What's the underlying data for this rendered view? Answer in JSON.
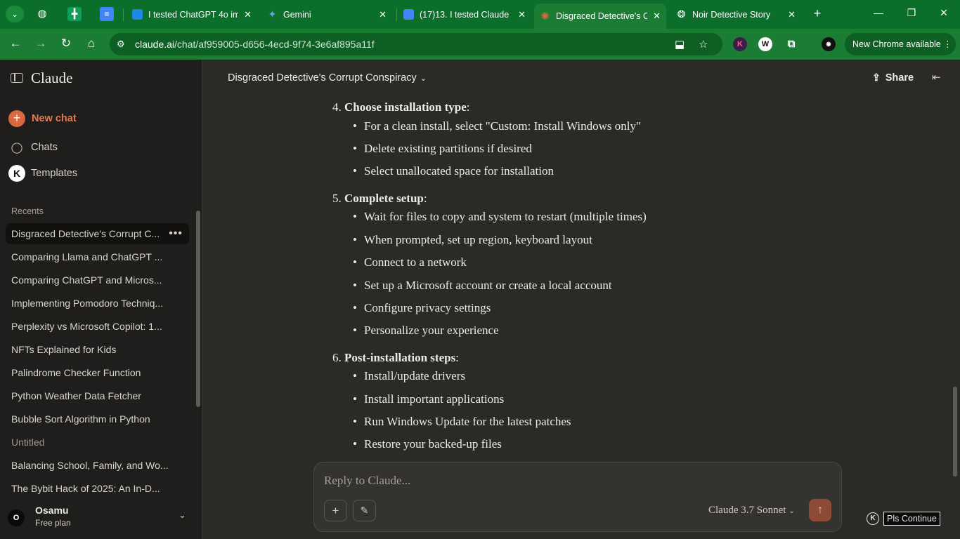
{
  "browser": {
    "tabs": [
      {
        "title": "I tested ChatGPT 4o im",
        "fav_color": "#1e88e5"
      },
      {
        "title": "Gemini",
        "fav_color": "#4d8af0"
      },
      {
        "title": "(17)13. I tested Claude",
        "fav_color": "#4285f4"
      },
      {
        "title": "Disgraced Detective's C",
        "fav_color": "#d9673f"
      },
      {
        "title": "Noir Detective Story",
        "fav_color": "#e8e8e8"
      }
    ],
    "url_host": "claude.ai",
    "url_path": "/chat/af959005-d656-4ecd-9f74-3e6af895a11f",
    "new_chrome_label": "New Chrome available"
  },
  "sidebar": {
    "brand": "Claude",
    "new_chat": "New chat",
    "nav": [
      {
        "label": "Chats",
        "icon": "chat-bubble-icon"
      },
      {
        "label": "Templates",
        "icon": "k-logo-icon"
      }
    ],
    "recents_heading": "Recents",
    "recents": [
      "Disgraced Detective's Corrupt C...",
      "Comparing Llama and ChatGPT ...",
      "Comparing ChatGPT and Micros...",
      "Implementing Pomodoro Techniq...",
      "Perplexity vs Microsoft Copilot: 1...",
      "NFTs Explained for Kids",
      "Palindrome Checker Function",
      "Python Weather Data Fetcher",
      "Bubble Sort Algorithm in Python",
      "Untitled",
      "Balancing School, Family, and Wo...",
      "The Bybit Hack of 2025: An In-D..."
    ],
    "user": {
      "initial": "O",
      "name": "Osamu",
      "plan": "Free plan"
    }
  },
  "header": {
    "chat_title": "Disgraced Detective's Corrupt Conspiracy",
    "share": "Share"
  },
  "content": {
    "steps": [
      {
        "number": "4.",
        "title": "Choose installation type",
        "bullets": [
          "For a clean install, select \"Custom: Install Windows only\"",
          "Delete existing partitions if desired",
          "Select unallocated space for installation"
        ]
      },
      {
        "number": "5.",
        "title": "Complete setup",
        "bullets": [
          "Wait for files to copy and system to restart (multiple times)",
          "When prompted, set up region, keyboard layout",
          "Connect to a network",
          "Set up a Microsoft account or create a local account",
          "Configure privacy settings",
          "Personalize your experience"
        ]
      },
      {
        "number": "6.",
        "title": "Post-installation steps",
        "bullets": [
          "Install/update drivers",
          "Install important applications",
          "Run Windows Update for the latest patches",
          "Restore your backed-up files"
        ]
      }
    ]
  },
  "composer": {
    "placeholder": "Reply to Claude...",
    "model": "Claude 3.7 Sonnet"
  },
  "overlay": {
    "button": "Pls Continue",
    "icon_letter": "K"
  }
}
